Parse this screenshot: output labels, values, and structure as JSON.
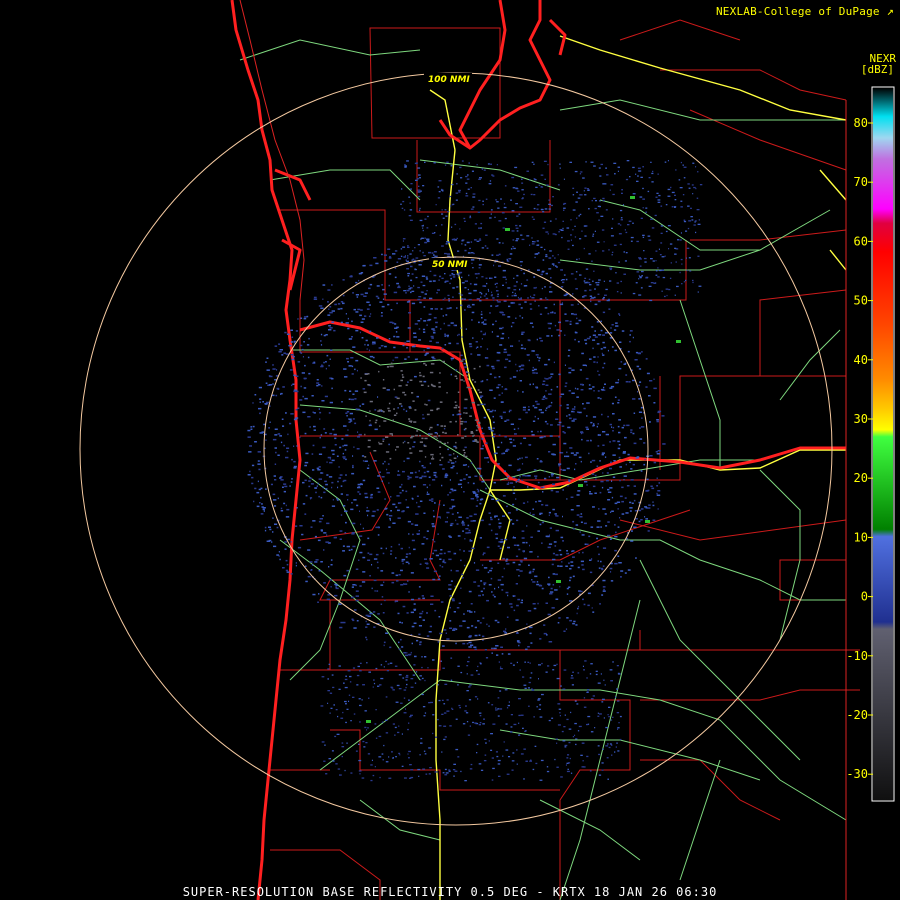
{
  "header": {
    "credit": "NEXLAB-College of DuPage",
    "link_icon": "external-link-icon",
    "product_code": "NEXR",
    "unit_label": "[dBZ]"
  },
  "footer": {
    "caption": "SUPER-RESOLUTION BASE REFLECTIVITY 0.5 DEG - KRTX 18 JAN 26 06:30"
  },
  "range_rings": [
    {
      "label": "50 NMI"
    },
    {
      "label": "100 NMI"
    }
  ],
  "colorbar": {
    "ticks": [
      "80",
      "70",
      "60",
      "50",
      "40",
      "30",
      "20",
      "10",
      "0",
      "-10",
      "-20",
      "-30"
    ],
    "colors": {
      "background": "#000000",
      "ring": "#f4c9a0",
      "state_border": "#ff2020",
      "county_border": "#cc1a1a",
      "highway": "#ffff40",
      "road": "#7ed87e",
      "river": "#a8d8a8"
    }
  }
}
